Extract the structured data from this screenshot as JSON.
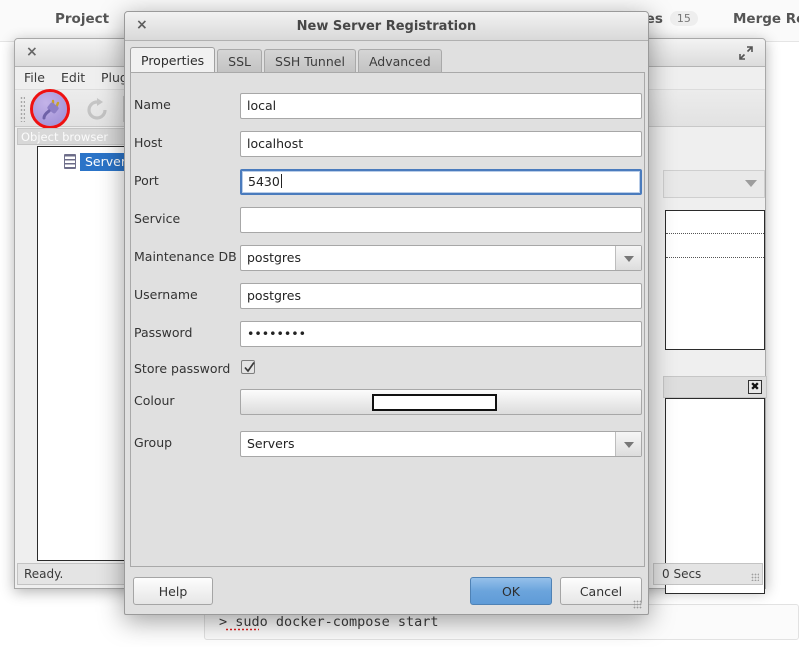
{
  "background_page": {
    "nav": {
      "project": "Project",
      "issues_label": "ssues",
      "issues_count": "15",
      "merge_requests": "Merge Re"
    },
    "code_block": {
      "prompt": "> ",
      "command": "sudo docker-compose start"
    }
  },
  "pgadmin_window": {
    "close_icon": "×",
    "menus": [
      {
        "label": "File"
      },
      {
        "label": "Edit"
      },
      {
        "label": "Plugin"
      }
    ],
    "object_browser_title": "Object browser",
    "tree": {
      "items": [
        {
          "label": "Server Gro"
        }
      ]
    },
    "status_left": "Ready.",
    "status_right": "0 Secs"
  },
  "dialog": {
    "title": "New Server Registration",
    "close_icon": "×",
    "tabs": [
      {
        "label": "Properties",
        "active": true
      },
      {
        "label": "SSL",
        "active": false
      },
      {
        "label": "SSH Tunnel",
        "active": false
      },
      {
        "label": "Advanced",
        "active": false
      }
    ],
    "fields": {
      "name": {
        "label": "Name",
        "value": "local"
      },
      "host": {
        "label": "Host",
        "value": "localhost"
      },
      "port": {
        "label": "Port",
        "value": "5430",
        "focused": true
      },
      "service": {
        "label": "Service",
        "value": ""
      },
      "maint_db": {
        "label": "Maintenance DB",
        "value": "postgres"
      },
      "username": {
        "label": "Username",
        "value": "postgres"
      },
      "password": {
        "label": "Password",
        "value": "••••••••"
      },
      "store_pw": {
        "label": "Store password",
        "checked": true
      },
      "colour": {
        "label": "Colour",
        "value": ""
      },
      "group": {
        "label": "Group",
        "value": "Servers"
      }
    },
    "buttons": {
      "help": "Help",
      "ok": "OK",
      "cancel": "Cancel"
    }
  },
  "colors": {
    "dialog_bg": "#e0e0e0",
    "accent_blue": "#6ba4dc",
    "focus_border": "#4a7bbd",
    "tree_selection": "#2b74c8",
    "highlight_ring": "#ee1111"
  }
}
